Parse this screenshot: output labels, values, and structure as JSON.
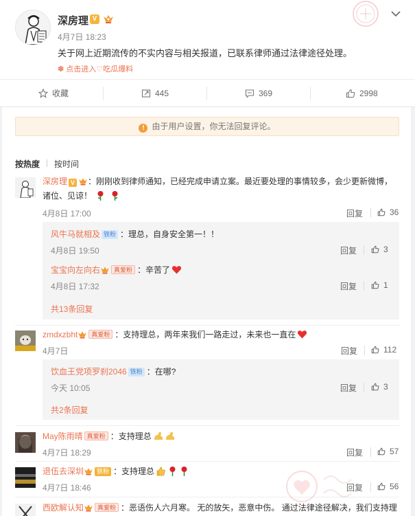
{
  "post": {
    "author": "深房理",
    "time": "4月7日 18:23",
    "text": "关于网上近期流传的不实内容与相关报道，已联系律师通过法律途径处理。",
    "topic": "点击进入♡吃瓜爆料"
  },
  "actions": {
    "favorite": "收藏",
    "repost": "445",
    "comment": "369",
    "like": "2998"
  },
  "notice": "由于用户设置，你无法回复评论。",
  "sort": {
    "hot": "按热度",
    "time": "按时间"
  },
  "reply_label": "回复",
  "comments": [
    {
      "user": "深房理",
      "text_line1": "：刚刚收到律师通知，已经完成申请立案。最近要处理的事情较多，会少更新微博，",
      "text_line2": "诸位、见谅！",
      "time": "4月8日 17:00",
      "likes": "36",
      "sub": [
        {
          "user": "风牛马就相及",
          "tag": "铁粉",
          "text": "：理总，自身安全第一！！",
          "time": "4月8日 19:50",
          "likes": "3"
        },
        {
          "user": "宝宝向左向右",
          "tag": "真爱粉",
          "text": "：辛苦了",
          "time": "4月8日 17:32",
          "likes": "1"
        }
      ],
      "more": "共13条回复"
    },
    {
      "user": "zmdxzbht",
      "tag": "真爱粉",
      "text": "：支持理总，两年来我们一路走过，未来也一直在",
      "time": "4月7日",
      "likes": "112",
      "sub": [
        {
          "user": "饮血王党项罗刹2046",
          "tag": "铁粉",
          "text": "：在哪?",
          "time": "今天 10:05",
          "likes": "3"
        }
      ],
      "more": "共2条回复"
    },
    {
      "user": "May陈雨晴",
      "tag": "真爱粉",
      "text": "：支持理总",
      "time": "4月7日 18:29",
      "likes": "57"
    },
    {
      "user": "退伍去深圳",
      "tag": "铁粉",
      "text": "：支持理总",
      "time": "4月7日 18:46",
      "likes": "56"
    },
    {
      "user": "西欧解认知",
      "tag": "真爱粉",
      "text": "：恶语伤人六月寒。 无的放矢，恶意中伤。 通过法律途径解决，我们支持理"
    }
  ],
  "colors": {
    "accent": "#eb7350",
    "text": "#333333",
    "muted": "#888888",
    "notice_bg": "#fdf3e7",
    "sub_bg": "#f4f4f4"
  }
}
